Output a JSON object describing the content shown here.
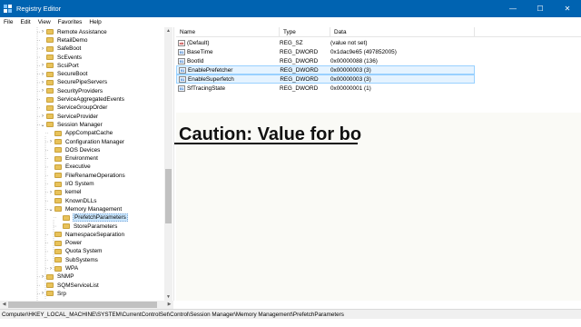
{
  "window": {
    "title": "Registry Editor",
    "controls": {
      "minimize": "—",
      "maximize": "☐",
      "close": "✕"
    }
  },
  "menu": [
    "File",
    "Edit",
    "View",
    "Favorites",
    "Help"
  ],
  "tree": [
    {
      "label": "Remote Assistance",
      "expander": "›",
      "level": 0
    },
    {
      "label": "RetailDemo",
      "expander": "",
      "level": 0
    },
    {
      "label": "SafeBoot",
      "expander": "›",
      "level": 0
    },
    {
      "label": "ScEvents",
      "expander": "",
      "level": 0
    },
    {
      "label": "ScsiPort",
      "expander": "›",
      "level": 0
    },
    {
      "label": "SecureBoot",
      "expander": "›",
      "level": 0
    },
    {
      "label": "SecurePipeServers",
      "expander": "›",
      "level": 0
    },
    {
      "label": "SecurityProviders",
      "expander": "›",
      "level": 0
    },
    {
      "label": "ServiceAggregatedEvents",
      "expander": "",
      "level": 0
    },
    {
      "label": "ServiceGroupOrder",
      "expander": "",
      "level": 0
    },
    {
      "label": "ServiceProvider",
      "expander": "›",
      "level": 0
    },
    {
      "label": "Session Manager",
      "expander": "⌄",
      "level": 0
    },
    {
      "label": "AppCompatCache",
      "expander": "",
      "level": 1
    },
    {
      "label": "Configuration Manager",
      "expander": "›",
      "level": 1
    },
    {
      "label": "DOS Devices",
      "expander": "",
      "level": 1
    },
    {
      "label": "Environment",
      "expander": "",
      "level": 1
    },
    {
      "label": "Executive",
      "expander": "",
      "level": 1
    },
    {
      "label": "FileRenameOperations",
      "expander": "",
      "level": 1
    },
    {
      "label": "I/O System",
      "expander": "",
      "level": 1
    },
    {
      "label": "kernel",
      "expander": "›",
      "level": 1
    },
    {
      "label": "KnownDLLs",
      "expander": "",
      "level": 1
    },
    {
      "label": "Memory Management",
      "expander": "⌄",
      "level": 1
    },
    {
      "label": "PrefetchParameters",
      "expander": "",
      "level": 2,
      "selected": true
    },
    {
      "label": "StoreParameters",
      "expander": "",
      "level": 2
    },
    {
      "label": "NamespaceSeparation",
      "expander": "",
      "level": 1
    },
    {
      "label": "Power",
      "expander": "",
      "level": 1
    },
    {
      "label": "Quota System",
      "expander": "",
      "level": 1
    },
    {
      "label": "SubSystems",
      "expander": "",
      "level": 1
    },
    {
      "label": "WPA",
      "expander": "›",
      "level": 1
    },
    {
      "label": "SNMP",
      "expander": "›",
      "level": 0
    },
    {
      "label": "SQMServiceList",
      "expander": "",
      "level": 0
    },
    {
      "label": "Srp",
      "expander": "›",
      "level": 0
    }
  ],
  "values": {
    "columns": [
      "Name",
      "Type",
      "Data"
    ],
    "rows": [
      {
        "icon": "string-value-icon",
        "glyph": "ab",
        "name": "(Default)",
        "type": "REG_SZ",
        "data": "(value not set)",
        "selected": false
      },
      {
        "icon": "dword-value-icon",
        "glyph": "01",
        "name": "BaseTime",
        "type": "REG_DWORD",
        "data": "0x1dac9e65 (497852005)",
        "selected": false
      },
      {
        "icon": "dword-value-icon",
        "glyph": "01",
        "name": "BootId",
        "type": "REG_DWORD",
        "data": "0x00000088 (136)",
        "selected": false
      },
      {
        "icon": "dword-value-icon",
        "glyph": "01",
        "name": "EnablePrefetcher",
        "type": "REG_DWORD",
        "data": "0x00000003 (3)",
        "selected": true
      },
      {
        "icon": "dword-value-icon",
        "glyph": "01",
        "name": "EnableSuperfetch",
        "type": "REG_DWORD",
        "data": "0x00000003 (3)",
        "selected": true
      },
      {
        "icon": "dword-value-icon",
        "glyph": "01",
        "name": "SfTracingState",
        "type": "REG_DWORD",
        "data": "0x00000001 (1)",
        "selected": false
      }
    ]
  },
  "caption": "Caution: Value for bo",
  "status_path": "Computer\\HKEY_LOCAL_MACHINE\\SYSTEM\\CurrentControlSet\\Control\\Session Manager\\Memory Management\\PrefetchParameters",
  "colors": {
    "titlebar": "#0063b1",
    "selection": "#cce8ff",
    "folder": "#e8c25a"
  }
}
